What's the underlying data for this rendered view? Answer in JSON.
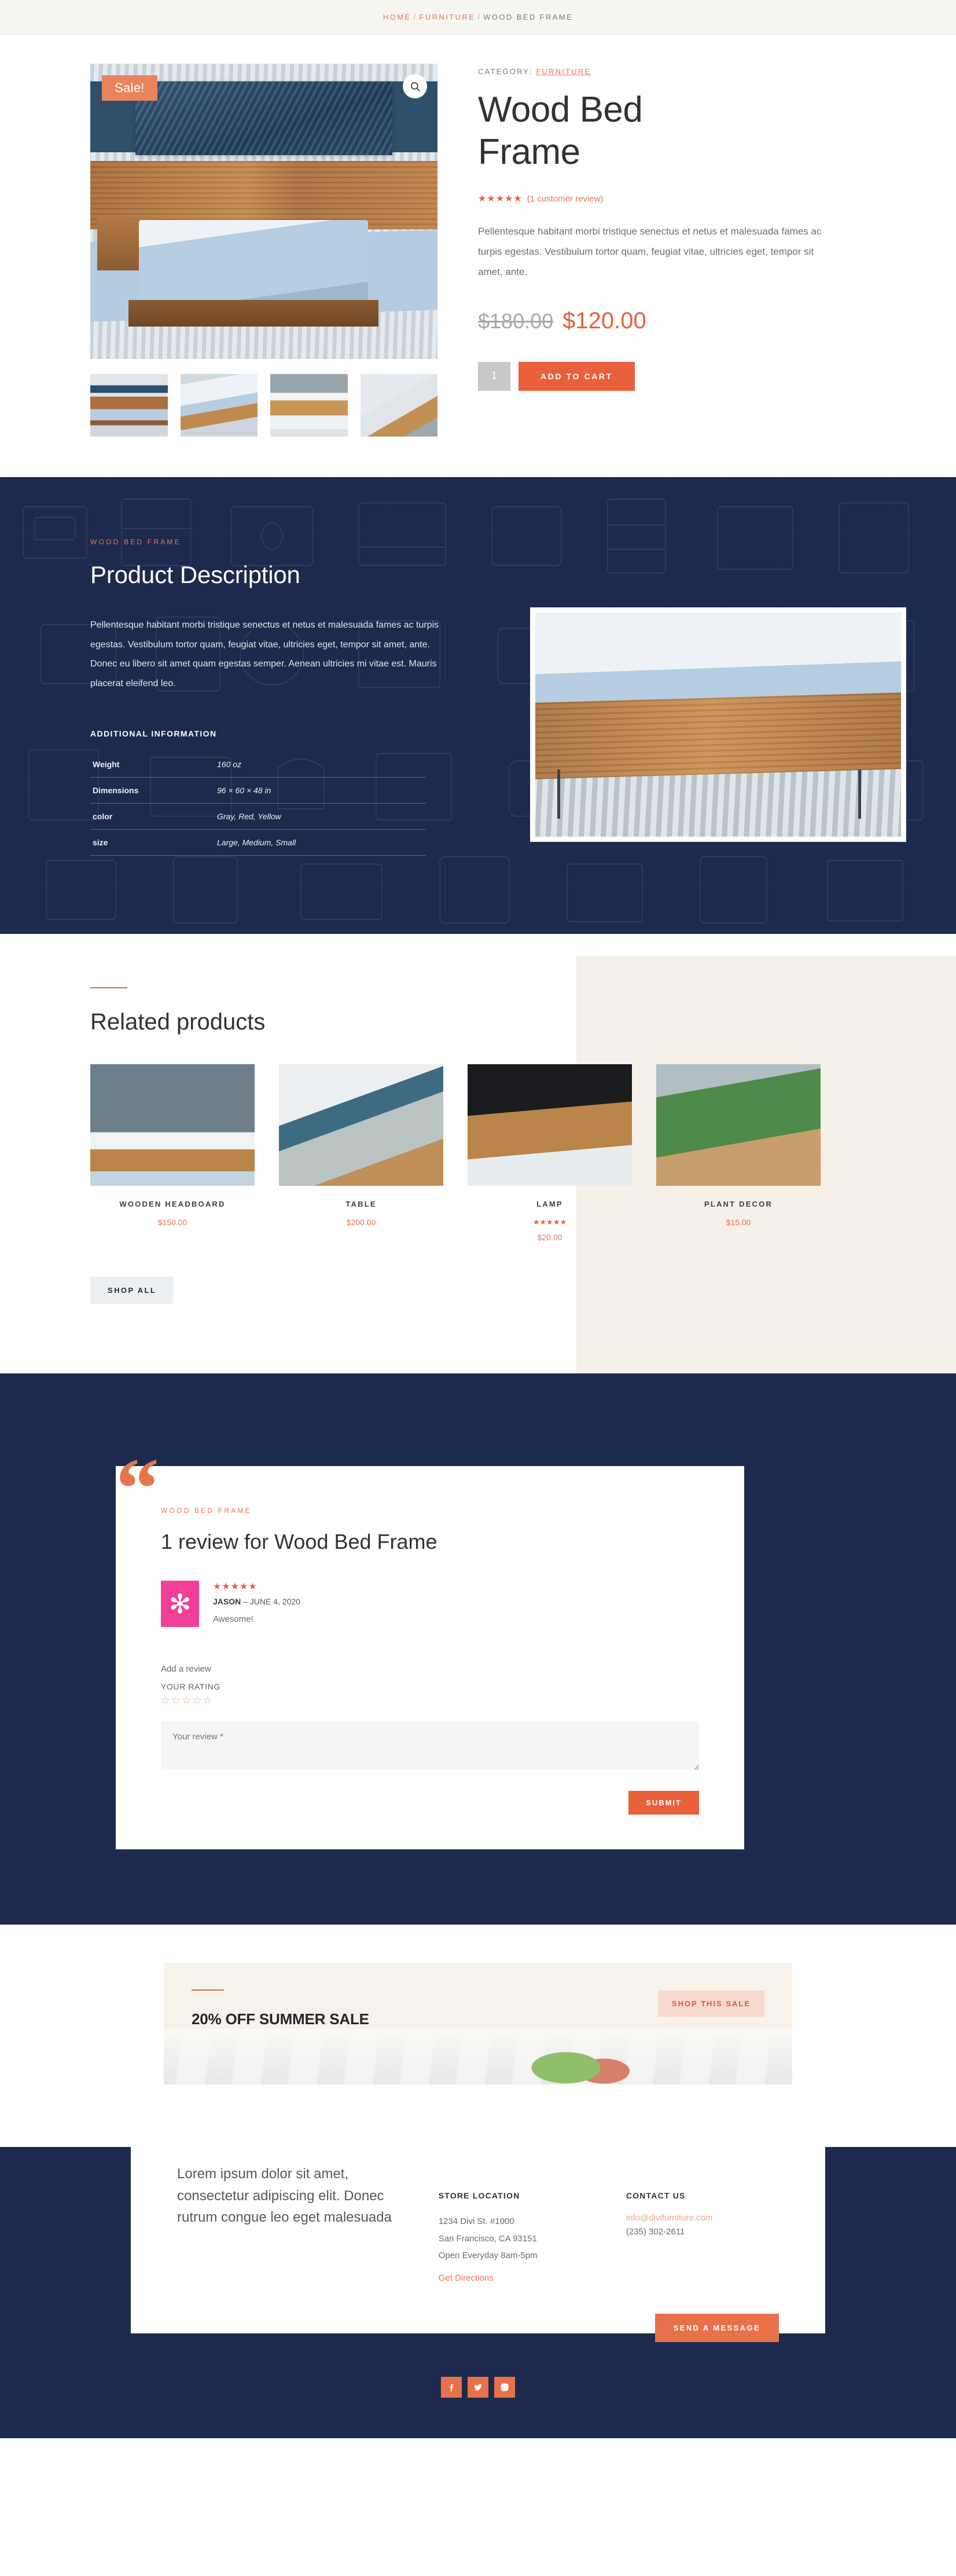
{
  "breadcrumb": {
    "home": "HOME",
    "category": "FURNITURE",
    "current": "WOOD BED FRAME",
    "separator": "/"
  },
  "product": {
    "sale_badge": "Sale!",
    "category_label": "CATEGORY:",
    "category_value": "FURNITURE",
    "title": "Wood Bed Frame",
    "stars": "★★★★★",
    "review_link": "(1 customer review)",
    "short_description": "Pellentesque habitant morbi tristique senectus et netus et malesuada fames ac turpis egestas. Vestibulum tortor quam, feugiat vitae, ultricies eget, tempor sit amet, ante.",
    "price_old": "$180.00",
    "price_new": "$120.00",
    "quantity": "1",
    "add_to_cart": "ADD TO CART",
    "zoom_icon": "magnifier-icon"
  },
  "description": {
    "eyebrow": "WOOD BED FRAME",
    "heading": "Product Description",
    "body": "Pellentesque habitant morbi tristique senectus et netus et malesuada fames ac turpis egestas. Vestibulum tortor quam, feugiat vitae, ultricies eget, tempor sit amet, ante. Donec eu libero sit amet quam egestas semper. Aenean ultricies mi vitae est. Mauris placerat eleifend leo.",
    "additional_info_heading": "ADDITIONAL INFORMATION",
    "attributes": [
      {
        "key": "Weight",
        "value": "160 oz"
      },
      {
        "key": "Dimensions",
        "value": "96 × 60 × 48 in"
      },
      {
        "key": "color",
        "value": "Gray, Red, Yellow"
      },
      {
        "key": "size",
        "value": "Large, Medium, Small"
      }
    ]
  },
  "related": {
    "heading": "Related products",
    "shop_all": "SHOP ALL",
    "products": [
      {
        "name": "WOODEN HEADBOARD",
        "price": "$150.00",
        "stars": ""
      },
      {
        "name": "TABLE",
        "price": "$200.00",
        "stars": ""
      },
      {
        "name": "LAMP",
        "price": "$20.00",
        "stars": "★★★★★"
      },
      {
        "name": "PLANT DECOR",
        "price": "$15.00",
        "stars": ""
      }
    ]
  },
  "reviews": {
    "eyebrow": "WOOD BED FRAME",
    "heading": "1 review for Wood Bed Frame",
    "items": [
      {
        "stars": "★★★★★",
        "author": "JASON",
        "date": "– JUNE 4, 2020",
        "text": "Awesome!",
        "avatar_glyph": "✻"
      }
    ],
    "add_review_label": "Add a review",
    "your_rating_label": "YOUR RATING",
    "rating_stars": "☆☆☆☆☆",
    "textarea_placeholder": "Your review *",
    "submit": "SUBMIT"
  },
  "sale_banner": {
    "title": "20% OFF SUMMER SALE",
    "button": "SHOP THIS SALE"
  },
  "footer": {
    "blurb": "Lorem ipsum dolor sit amet, consectetur adipiscing elit. Donec rutrum congue leo eget malesuada",
    "store": {
      "heading": "STORE LOCATION",
      "line1": "1234 Divi St. #1000",
      "line2": "San Francisco, CA 93151",
      "line3": "Open Everyday 8am-5pm",
      "directions": "Get Directions"
    },
    "contact": {
      "heading": "CONTACT US",
      "email": "info@divifurniture.com",
      "phone": "(235) 302-2611"
    },
    "send_message": "SEND A MESSAGE",
    "social": [
      {
        "name": "facebook-icon"
      },
      {
        "name": "twitter-icon"
      },
      {
        "name": "instagram-icon"
      }
    ]
  },
  "colors": {
    "accent": "#e8603c",
    "dark": "#1d2a4d",
    "beige": "#f5f0e8",
    "breadcrumb_bg": "#f7f5f0"
  }
}
